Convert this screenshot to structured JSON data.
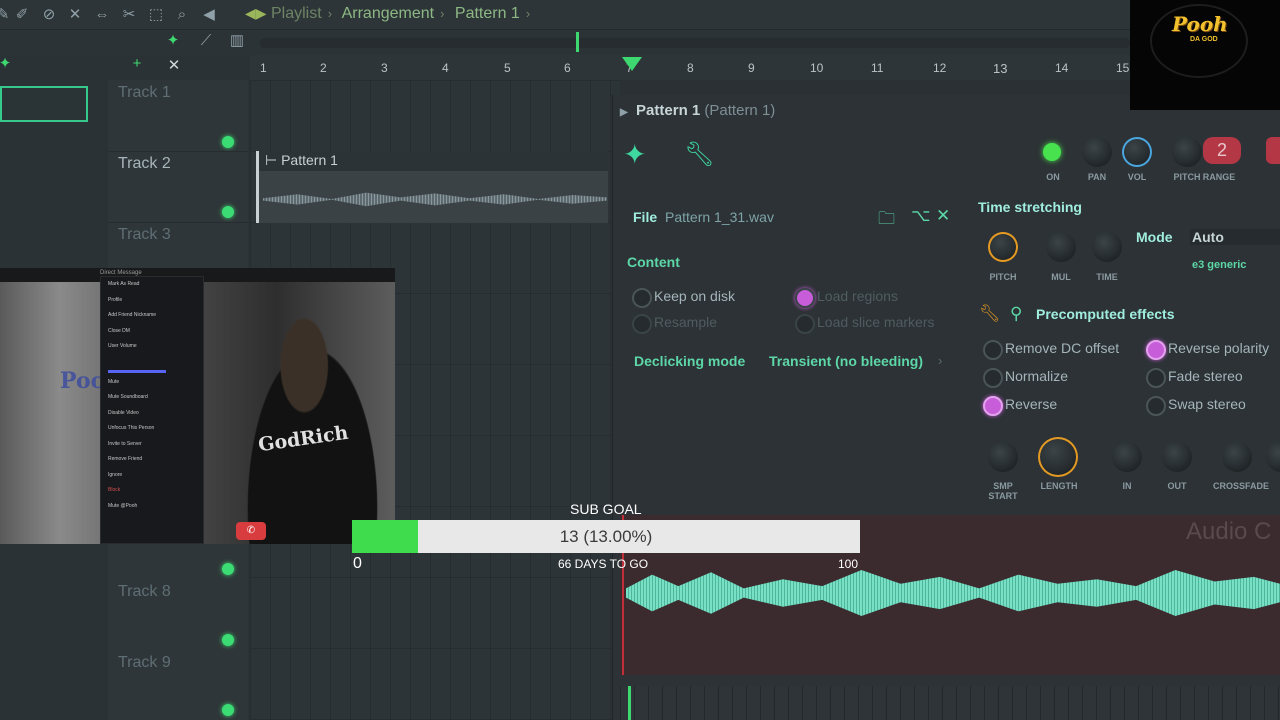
{
  "breadcrumbs": {
    "playlist": "Playlist",
    "arrangement": "Arrangement",
    "pattern": "Pattern 1"
  },
  "ruler": [
    "1",
    "2",
    "3",
    "4",
    "5",
    "6",
    "7",
    "8",
    "9",
    "10",
    "11",
    "12",
    "13",
    "14",
    "15"
  ],
  "tracks": [
    {
      "name": "Track 1",
      "active": false
    },
    {
      "name": "Track 2",
      "active": true
    },
    {
      "name": "Track 3",
      "active": false
    },
    {
      "name": "Track 8",
      "active": false
    },
    {
      "name": "Track 9",
      "active": false
    }
  ],
  "pattern_clip": {
    "label": "Pattern 1"
  },
  "channel": {
    "title": "Pattern 1",
    "title_sub": "(Pattern 1)",
    "knobs": {
      "on": "ON",
      "pan": "PAN",
      "vol": "VOL",
      "pitch": "PITCH",
      "range": "RANGE",
      "range_value": "2"
    },
    "file_label": "File",
    "file_name": "Pattern 1_31.wav",
    "content_label": "Content",
    "keep_on_disk": "Keep on disk",
    "resample": "Resample",
    "load_regions": "Load regions",
    "load_slice_markers": "Load slice markers",
    "declicking_label": "Declicking mode",
    "declicking_value": "Transient (no bleeding)",
    "time_stretching": "Time stretching",
    "ts_knobs": {
      "pitch": "PITCH",
      "mul": "MUL",
      "time": "TIME"
    },
    "mode_label": "Mode",
    "mode_value": "Auto",
    "mode_sub": "e3 generic",
    "precomputed": "Precomputed effects",
    "effects": {
      "remove_dc": "Remove DC offset",
      "normalize": "Normalize",
      "reverse": "Reverse",
      "reverse_polarity": "Reverse polarity",
      "fade_stereo": "Fade stereo",
      "swap_stereo": "Swap stereo"
    },
    "bottom_knobs": {
      "smp_start": "SMP START",
      "length": "LENGTH",
      "in": "IN",
      "out": "OUT",
      "crossfade": "CROSSFADE"
    },
    "audio_clip_title": "Audio C"
  },
  "goal": {
    "title": "SUB GOAL",
    "progress_text": "13 (13.00%)",
    "progress_fraction": 0.13,
    "min": "0",
    "max": "100",
    "days": "66 DAYS TO GO"
  },
  "brand": {
    "name": "Pooh",
    "sub": "DA GOD"
  },
  "cam": {
    "shirt_text": "GodRich",
    "watermark": "Pooh",
    "header": "Direct Message",
    "menu": [
      "Mark As Read",
      "Profile",
      "Add Friend Nickname",
      "Close DM",
      "User Volume",
      "Mute",
      "Mute Soundboard",
      "Disable Video",
      "Unfocus This Person",
      "Invite to Server",
      "Remove Friend",
      "Ignore",
      "Block",
      "Mute @Pooh"
    ]
  },
  "colors": {
    "accent_green": "#3ed870",
    "teal_section": "#5dd7a7",
    "goal_fill": "#3fdc4e",
    "effect_on": "#c75dd9"
  }
}
